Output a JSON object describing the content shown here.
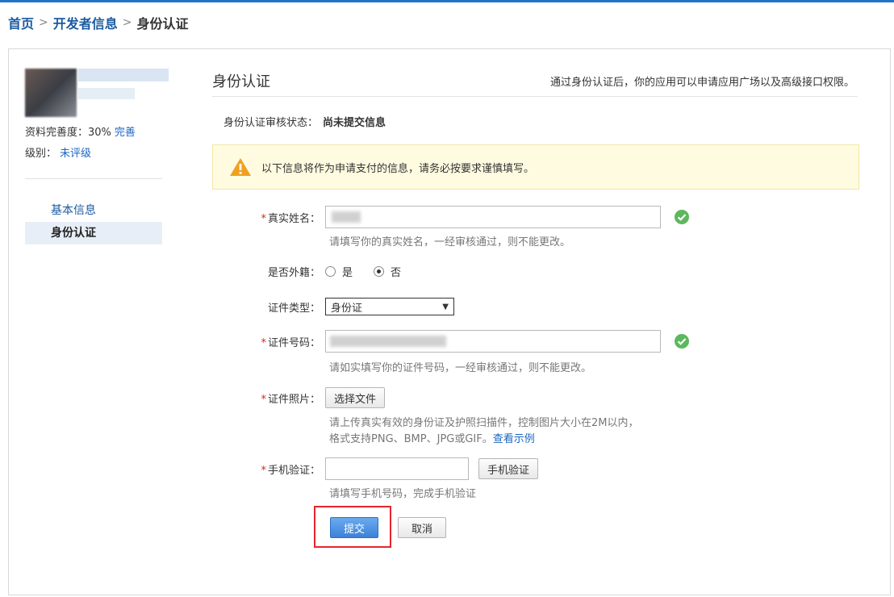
{
  "breadcrumb": {
    "home": "首页",
    "developer": "开发者信息",
    "current": "身份认证",
    "separator": ">"
  },
  "sidebar": {
    "profile_completion_label": "资料完善度：",
    "profile_completion_value": "30%",
    "profile_completion_link": "完善",
    "level_label": "级别：",
    "level_value": "未评级",
    "items": [
      {
        "label": "基本信息",
        "active": false
      },
      {
        "label": "身份认证",
        "active": true
      }
    ]
  },
  "main": {
    "title": "身份认证",
    "note": "通过身份认证后，你的应用可以申请应用广场以及高级接口权限。",
    "status_label": "身份认证审核状态：",
    "status_value": "尚未提交信息",
    "notice": "以下信息将作为申请支付的信息，请务必按要求谨慎填写。"
  },
  "form": {
    "required_mark": "*",
    "real_name": {
      "label": "真实姓名：",
      "hint": "请填写你的真实姓名，一经审核通过，则不能更改。"
    },
    "foreign": {
      "label": "是否外籍：",
      "options": [
        "是",
        "否"
      ],
      "selected": "否"
    },
    "id_type": {
      "label": "证件类型：",
      "value": "身份证"
    },
    "id_number": {
      "label": "证件号码：",
      "hint": "请如实填写你的证件号码，一经审核通过，则不能更改。"
    },
    "id_photo": {
      "label": "证件照片：",
      "button": "选择文件",
      "hint_line1": "请上传真实有效的身份证及护照扫描件，控制图片大小在2M以内，",
      "hint_line2": "格式支持PNG、BMP、JPG或GIF。",
      "hint_link": "查看示例"
    },
    "phone": {
      "label": "手机验证：",
      "button": "手机验证",
      "hint": "请填写手机号码，完成手机验证"
    },
    "submit": "提交",
    "cancel": "取消"
  },
  "colors": {
    "accent": "#1f74c8",
    "link": "#1a66c0",
    "required": "#d9261c",
    "ok": "#5cb85c",
    "warning": "#f0a020",
    "highlight": "#e4262b"
  }
}
